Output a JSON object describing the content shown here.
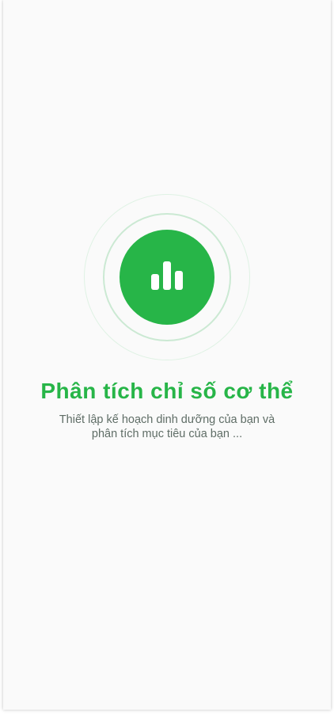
{
  "loading": {
    "title": "Phân tích chỉ số cơ thể",
    "subtitle_line1": "Thiết lập kế hoạch dinh dưỡng của bạn và",
    "subtitle_line2": "phân tích mục tiêu của bạn ...",
    "icon": "bar-chart-icon",
    "accent_color": "#27b548"
  }
}
